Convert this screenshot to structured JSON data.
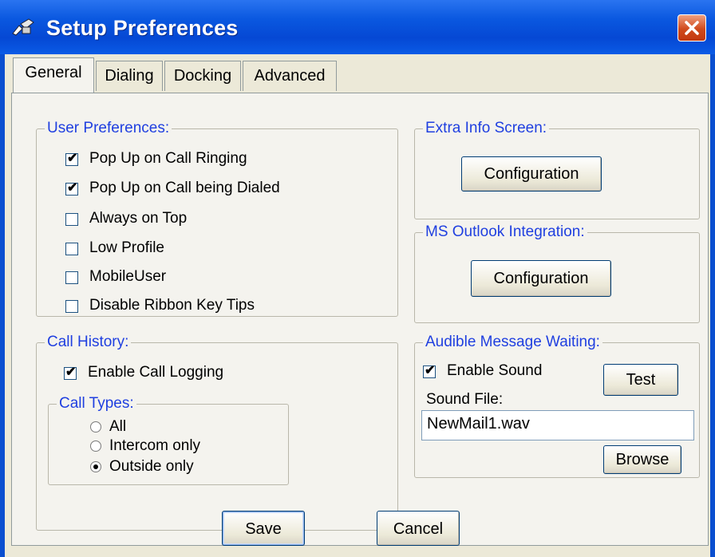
{
  "window": {
    "title": "Setup Preferences",
    "app_icon": "phone-app-icon",
    "close_icon": "close-icon",
    "colors": {
      "titlebar": "#0548d4",
      "close": "#d04a1c",
      "group_label": "#1f3fe0",
      "background": "#ece9d8"
    }
  },
  "tabs": [
    {
      "label": "General",
      "active": true
    },
    {
      "label": "Dialing",
      "active": false
    },
    {
      "label": "Docking",
      "active": false
    },
    {
      "label": "Advanced",
      "active": false
    }
  ],
  "user_preferences": {
    "legend": "User Preferences:",
    "items": [
      {
        "label": "Pop Up on Call Ringing",
        "checked": true
      },
      {
        "label": "Pop Up on Call being Dialed",
        "checked": true
      },
      {
        "label": "Always on Top",
        "checked": false
      },
      {
        "label": "Low Profile",
        "checked": false
      },
      {
        "label": "MobileUser",
        "checked": false
      },
      {
        "label": "Disable Ribbon Key Tips",
        "checked": false
      }
    ]
  },
  "extra_info": {
    "legend": "Extra Info Screen:",
    "button": "Configuration"
  },
  "outlook": {
    "legend": "MS Outlook Integration:",
    "button": "Configuration"
  },
  "call_history": {
    "legend": "Call History:",
    "enable_logging": {
      "label": "Enable Call Logging",
      "checked": true
    },
    "call_types": {
      "legend": "Call Types:",
      "options": [
        {
          "label": "All",
          "selected": false
        },
        {
          "label": "Intercom only",
          "selected": false
        },
        {
          "label": "Outside only",
          "selected": true
        }
      ]
    }
  },
  "audible": {
    "legend": "Audible Message Waiting:",
    "enable_sound": {
      "label": "Enable Sound",
      "checked": true
    },
    "test_button": "Test",
    "sound_file_label": "Sound File:",
    "sound_file_value": "NewMail1.wav",
    "browse_button": "Browse"
  },
  "footer": {
    "save": "Save",
    "cancel": "Cancel"
  }
}
